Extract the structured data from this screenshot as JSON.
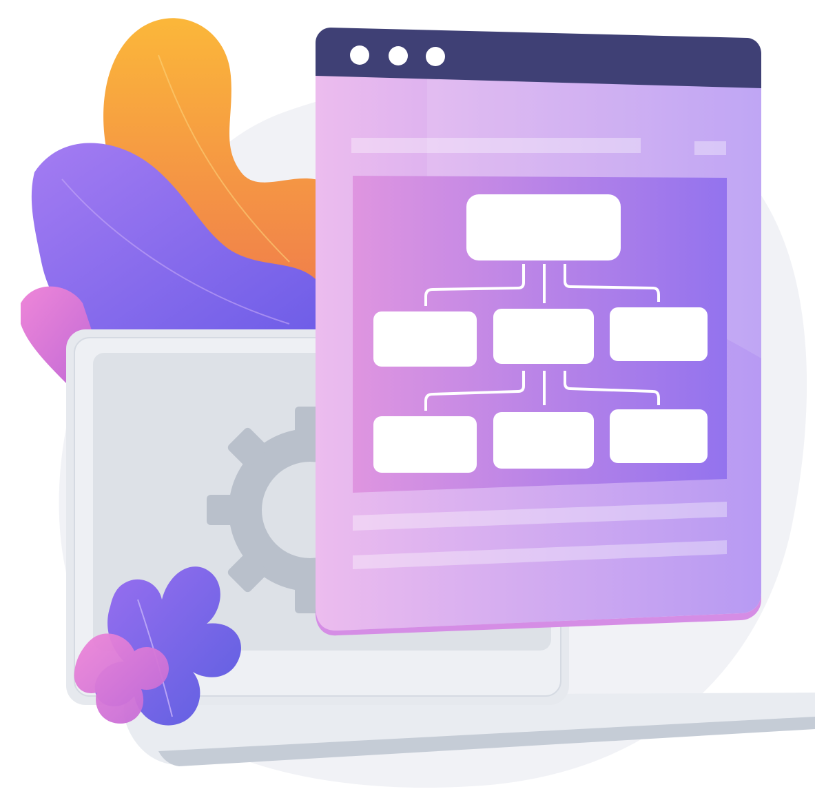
{
  "illustration": {
    "description_kind": "flat vector illustration, no visible text",
    "colors": {
      "background_blob": "#f1f2f6",
      "orange_leaf_top": "#fbb73a",
      "orange_leaf_bottom": "#f07e4b",
      "purple_leaf": "#8b6bf0",
      "pink_leaf": "#e07ad8",
      "laptop_frame": "#e6e9ee",
      "laptop_screen": "#d9dde4",
      "laptop_base": "#c8ced8",
      "gear": "#b9c0cb",
      "window_titlebar": "#3f4075",
      "window_dot": "#ffffff",
      "window_body_left": "#ecbcee",
      "window_body_right": "#b79af3",
      "panel_left": "#d98fdf",
      "panel_right": "#9573ee",
      "node_fill": "#ffffff",
      "connector": "#ffffff"
    },
    "window": {
      "dot_count": 3,
      "hierarchy_levels": [
        1,
        3,
        3
      ]
    },
    "icons": [
      "gear-icon",
      "window-dots-icon",
      "flowchart-icon"
    ]
  }
}
